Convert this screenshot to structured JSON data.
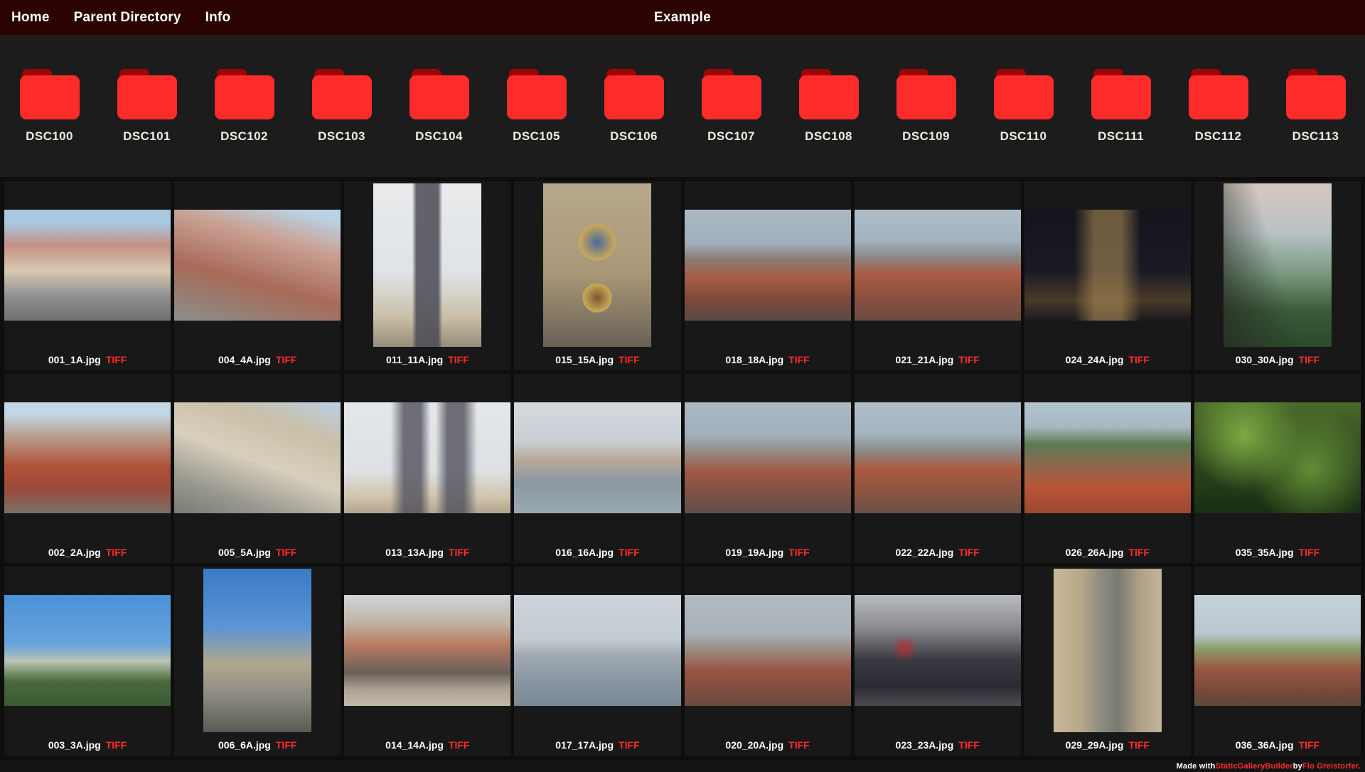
{
  "colors": {
    "header_bg": "#2b0303",
    "accent_red": "#fe2b2b",
    "tag_red": "#ff2424"
  },
  "header": {
    "title": "Example",
    "nav": [
      {
        "label": "Home"
      },
      {
        "label": "Parent Directory"
      },
      {
        "label": "Info"
      }
    ]
  },
  "folders": {
    "items": [
      {
        "label": "DSC100"
      },
      {
        "label": "DSC101"
      },
      {
        "label": "DSC102"
      },
      {
        "label": "DSC103"
      },
      {
        "label": "DSC104"
      },
      {
        "label": "DSC105"
      },
      {
        "label": "DSC106"
      },
      {
        "label": "DSC107"
      },
      {
        "label": "DSC108"
      },
      {
        "label": "DSC109"
      },
      {
        "label": "DSC110"
      },
      {
        "label": "DSC111"
      },
      {
        "label": "DSC112"
      },
      {
        "label": "DSC113"
      }
    ]
  },
  "gallery": {
    "tag_label": "TIFF",
    "images": [
      {
        "name": "001_1A.jpg",
        "tag": "TIFF",
        "orientation": "landscape",
        "bg": "linear-gradient(180deg,#a8c8e0 0%,#a8c8e0 12%,#c49086 32%,#d8c9b0 55%,#909090 78%,#6f6f6f 100%)"
      },
      {
        "name": "004_4A.jpg",
        "tag": "TIFF",
        "orientation": "landscape",
        "bg": "linear-gradient(195deg,#b9d2e4 0%,#b9d2e4 8%,#c9a193 30%,#a86a58 62%,#8a8f8a 100%)"
      },
      {
        "name": "011_11A.jpg",
        "tag": "TIFF",
        "orientation": "portrait",
        "bg": "linear-gradient(90deg,rgba(233,235,236,0) 36%,rgba(74,74,84,0.85) 40%,rgba(74,74,84,0.85) 60%,rgba(233,235,236,0) 64%),linear-gradient(180deg,#e9ebec 0%,#dfe3e6 55%,#c9bfa8 82%,#978c7a 100%)"
      },
      {
        "name": "015_15A.jpg",
        "tag": "TIFF",
        "orientation": "portrait",
        "bg": "radial-gradient(circle at 50% 36%,#4a6a9a 0%,#c9a85a 15%,rgba(201,168,90,0) 16%),radial-gradient(circle at 50% 70%,#7a5a2a 0%,#c9a85a 11%,rgba(0,0,0,0) 12%),linear-gradient(180deg,#b9a98c 0%,#a89878 55%,#6a6055 100%)"
      },
      {
        "name": "018_18A.jpg",
        "tag": "TIFF",
        "orientation": "landscape",
        "bg": "linear-gradient(180deg,#a9b9c4 0%,#9fb0bc 30%,#8a7a72 45%,#a85a44 62%,#7a4a3c 82%,#5a4a44 100%)"
      },
      {
        "name": "021_21A.jpg",
        "tag": "TIFF",
        "orientation": "landscape",
        "bg": "linear-gradient(180deg,#aebeca 0%,#a2b2bf 28%,#8a8a88 42%,#aa5a42 58%,#8a5040 80%,#6a4a40 100%)"
      },
      {
        "name": "024_24A.jpg",
        "tag": "TIFF",
        "orientation": "landscape",
        "bg": "linear-gradient(90deg,rgba(20,20,28,0) 30%,rgba(185,150,90,0.55) 42%,rgba(185,150,90,0.55) 58%,rgba(20,20,28,0) 70%),linear-gradient(180deg,#14141c 0%,#1a1a24 55%,#4a3a28 82%,#1a1a20 100%)"
      },
      {
        "name": "030_30A.jpg",
        "tag": "TIFF",
        "orientation": "portrait",
        "bg": "linear-gradient(75deg,rgba(40,45,35,0.85) 0%,rgba(40,45,35,0) 50%),linear-gradient(180deg,#d8c8c0 0%,#b8c2c4 30%,#7a9a80 55%,#3a5a38 78%,#2a4a2c 100%)"
      },
      {
        "name": "002_2A.jpg",
        "tag": "TIFF",
        "orientation": "landscape",
        "bg": "linear-gradient(180deg,#c2d8e8 0%,#c2d8e8 10%,#b8a090 30%,#b05038 58%,#9a4a3a 78%,#7a7068 100%)"
      },
      {
        "name": "005_5A.jpg",
        "tag": "TIFF",
        "orientation": "landscape",
        "bg": "linear-gradient(200deg,#b8d0e4 0%,#cabfa8 25%,#d8cfbc 52%,#9a9a90 78%,#7a7a72 100%)"
      },
      {
        "name": "013_13A.jpg",
        "tag": "TIFF",
        "orientation": "landscape",
        "bg": "linear-gradient(90deg,rgba(230,233,236,0) 28%,rgba(80,80,92,0.8) 36%,rgba(80,80,92,0.8) 46%,rgba(230,233,236,0) 52%,rgba(230,233,236,0) 55%,rgba(80,80,92,0.8) 62%,rgba(80,80,92,0.8) 72%,rgba(230,233,236,0) 80%),linear-gradient(180deg,#e4e7ea 0%,#dde1e4 62%,#cfc3ac 86%,#b0a48c 100%)"
      },
      {
        "name": "016_16A.jpg",
        "tag": "TIFF",
        "orientation": "landscape",
        "bg": "linear-gradient(180deg,#d4dade 0%,#c8cfd4 35%,#b8a898 52%,#8a98a2 72%,#9aa8b0 100%)"
      },
      {
        "name": "019_19A.jpg",
        "tag": "TIFF",
        "orientation": "landscape",
        "bg": "linear-gradient(180deg,#aab9c4 0%,#9fafbb 30%,#948a80 45%,#a05844 62%,#7a5044 85%,#60504a 100%)"
      },
      {
        "name": "022_22A.jpg",
        "tag": "TIFF",
        "orientation": "landscape",
        "bg": "linear-gradient(180deg,#b0bfca 0%,#a4b4c0 28%,#8a8a84 44%,#aa5a40 60%,#8a5440 82%,#6a5048 100%)"
      },
      {
        "name": "026_26A.jpg",
        "tag": "TIFF",
        "orientation": "landscape",
        "bg": "linear-gradient(180deg,#b4c4ce 0%,#a8b8c2 22%,#5a7a52 38%,#8a6a50 55%,#b85638 76%,#9a4830 100%)"
      },
      {
        "name": "035_35A.jpg",
        "tag": "TIFF",
        "orientation": "landscape",
        "bg": "radial-gradient(circle at 30% 30%,rgba(130,180,70,0.9) 0%,rgba(130,180,70,0) 40%),radial-gradient(circle at 70% 60%,rgba(110,160,60,0.8) 0%,rgba(110,160,60,0) 45%),linear-gradient(180deg,#4a6a2a 0%,#2a421c 60%,#1a2e12 100%)"
      },
      {
        "name": "003_3A.jpg",
        "tag": "TIFF",
        "orientation": "landscape",
        "bg": "linear-gradient(180deg,#4a90d8 0%,#6aa4dc 45%,#b8c4b0 60%,#4a6a3c 78%,#3a5a34 100%)"
      },
      {
        "name": "006_6A.jpg",
        "tag": "TIFF",
        "orientation": "portrait",
        "bg": "linear-gradient(180deg,#3a7ac8 0%,#5a94d4 35%,#b0a890 58%,#8a8a80 78%,#5a5a54 100%)"
      },
      {
        "name": "014_14A.jpg",
        "tag": "TIFF",
        "orientation": "landscape",
        "bg": "linear-gradient(180deg,#d0d4d8 0%,#c0b4a4 25%,#b87a62 45%,#6a6058 70%,#b0a494 86%,#c4b8a8 100%)"
      },
      {
        "name": "017_17A.jpg",
        "tag": "TIFF",
        "orientation": "landscape",
        "bg": "linear-gradient(180deg,#ccd4da 0%,#c2ccd2 40%,#a0a8b0 55%,#8a98a4 76%,#7a8894 100%)"
      },
      {
        "name": "020_20A.jpg",
        "tag": "TIFF",
        "orientation": "landscape",
        "bg": "linear-gradient(180deg,#b2bac2 0%,#a8b0b8 35%,#9a8a7e 50%,#985444 68%,#6a4a40 100%)"
      },
      {
        "name": "023_23A.jpg",
        "tag": "TIFF",
        "orientation": "landscape",
        "bg": "radial-gradient(circle at 30% 48%,rgba(200,40,40,0.8) 0%,rgba(200,40,40,0) 10%),linear-gradient(180deg,#b8bcc0 0%,#8a8a8e 30%,#3a3a42 58%,#2a2a32 82%,#4a4a50 100%)"
      },
      {
        "name": "029_29A.jpg",
        "tag": "TIFF",
        "orientation": "portrait",
        "bg": "linear-gradient(90deg,#c8b89c 0%,#b8a888 25%,#8a8a80 45%,#7a7a72 60%,#b0a088 80%,#c4b49a 100%)"
      },
      {
        "name": "036_36A.jpg",
        "tag": "TIFF",
        "orientation": "landscape",
        "bg": "linear-gradient(180deg,#c6d2da 0%,#bac6ce 35%,#8aa06a 48%,#9a5844 66%,#7a4838 86%,#5a4a3c 100%)"
      }
    ]
  },
  "footer": {
    "made_with": "Made with ",
    "builder_link": "StaticGalleryBuilder",
    "by": " by ",
    "author_link": "Flo Greistorfer."
  }
}
